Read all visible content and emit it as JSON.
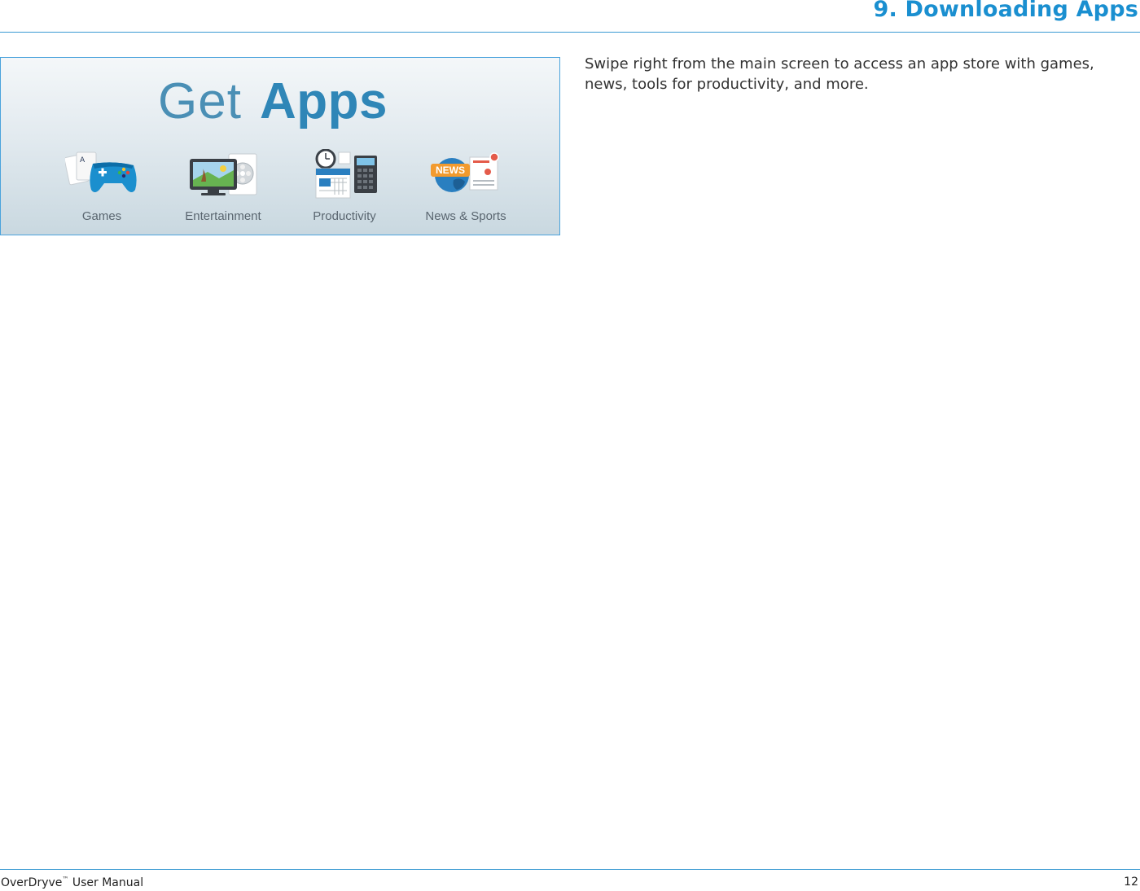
{
  "header": {
    "title": "9. Downloading Apps"
  },
  "figure": {
    "heading_light": "Get",
    "heading_bold": "Apps",
    "categories": [
      {
        "label": "Games",
        "icon": "gamepad-icon"
      },
      {
        "label": "Entertainment",
        "icon": "tv-film-icon"
      },
      {
        "label": "Productivity",
        "icon": "clock-calendar-calculator-icon"
      },
      {
        "label": "News & Sports",
        "icon": "news-globe-icon"
      }
    ],
    "news_badge": "NEWS"
  },
  "body": {
    "text": "Swipe right from the main screen to access an app store with games, news, tools for productivity, and more."
  },
  "footer": {
    "brand": "OverDryve",
    "trademark": "™",
    "manual": " User Manual",
    "page_number": "12"
  },
  "colors": {
    "accent": "#1a8fd0",
    "rule": "#3b9bd3"
  }
}
